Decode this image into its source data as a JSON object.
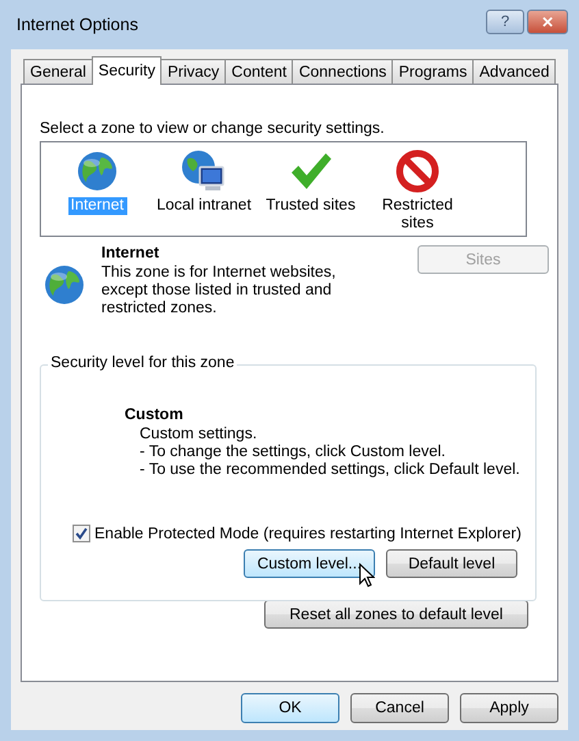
{
  "window": {
    "title": "Internet Options"
  },
  "title_buttons": [
    {
      "kind": "help",
      "label": "?"
    },
    {
      "kind": "close",
      "label": "✕"
    }
  ],
  "tabs": [
    {
      "label": "General",
      "selected": false
    },
    {
      "label": "Security",
      "selected": true
    },
    {
      "label": "Privacy",
      "selected": false
    },
    {
      "label": "Content",
      "selected": false
    },
    {
      "label": "Connections",
      "selected": false
    },
    {
      "label": "Programs",
      "selected": false
    },
    {
      "label": "Advanced",
      "selected": false
    }
  ],
  "zone_prompt": "Select a zone to view or change security settings.",
  "zones": [
    {
      "kind": "globe",
      "label": "Internet",
      "selected": true
    },
    {
      "kind": "intranet",
      "label": "Local intranet",
      "selected": false
    },
    {
      "kind": "check",
      "label": "Trusted sites",
      "selected": false
    },
    {
      "kind": "blocked",
      "label": "Restricted sites",
      "selected": false
    }
  ],
  "zone_info": {
    "title": "Internet",
    "description": "This zone is for Internet websites, except those listed in trusted and restricted zones.",
    "sites_button": {
      "label": "Sites",
      "disabled": true
    }
  },
  "security_level": {
    "legend": "Security level for this zone",
    "level_name": "Custom",
    "lines": [
      "Custom settings.",
      "- To change the settings, click Custom level.",
      "- To use the recommended settings, click Default level."
    ],
    "protected_mode": {
      "label": "Enable Protected Mode (requires restarting Internet Explorer)",
      "checked": true
    },
    "buttons": [
      {
        "label": "Custom level...",
        "focused": true
      },
      {
        "label": "Default level",
        "focused": false
      }
    ]
  },
  "reset_button": {
    "label": "Reset all zones to default level"
  },
  "dialog_buttons": [
    {
      "label": "OK",
      "default": true
    },
    {
      "label": "Cancel",
      "default": false
    },
    {
      "label": "Apply",
      "default": false
    }
  ]
}
